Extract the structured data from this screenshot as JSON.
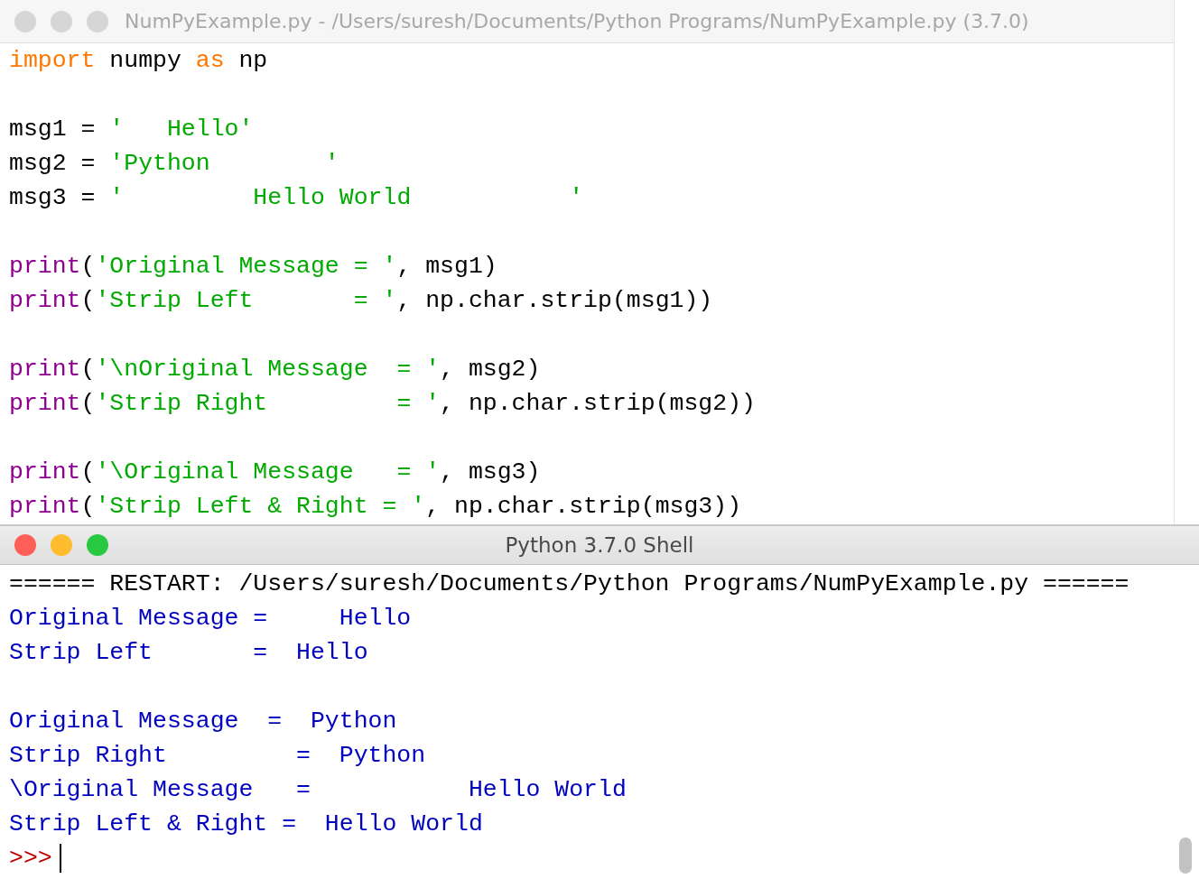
{
  "editor": {
    "title": "NumPyExample.py - /Users/suresh/Documents/Python Programs/NumPyExample.py (3.7.0)",
    "active": false,
    "blocks": [
      {
        "lines": [
          [
            {
              "kind": "keyword",
              "text": "import"
            },
            {
              "kind": "plain",
              "text": " numpy "
            },
            {
              "kind": "keyword",
              "text": "as"
            },
            {
              "kind": "plain",
              "text": " np"
            }
          ]
        ]
      },
      {
        "lines": [
          [
            {
              "kind": "plain",
              "text": "msg1 = "
            },
            {
              "kind": "string",
              "text": "'   Hello'"
            }
          ],
          [
            {
              "kind": "plain",
              "text": "msg2 = "
            },
            {
              "kind": "string",
              "text": "'Python        '"
            }
          ],
          [
            {
              "kind": "plain",
              "text": "msg3 = "
            },
            {
              "kind": "string",
              "text": "'         Hello World           '"
            }
          ]
        ]
      },
      {
        "lines": [
          [
            {
              "kind": "builtin",
              "text": "print"
            },
            {
              "kind": "plain",
              "text": "("
            },
            {
              "kind": "string",
              "text": "'Original Message = '"
            },
            {
              "kind": "plain",
              "text": ", msg1)"
            }
          ],
          [
            {
              "kind": "builtin",
              "text": "print"
            },
            {
              "kind": "plain",
              "text": "("
            },
            {
              "kind": "string",
              "text": "'Strip Left       = '"
            },
            {
              "kind": "plain",
              "text": ", np.char.strip(msg1))"
            }
          ]
        ]
      },
      {
        "lines": [
          [
            {
              "kind": "builtin",
              "text": "print"
            },
            {
              "kind": "plain",
              "text": "("
            },
            {
              "kind": "string",
              "text": "'\\nOriginal Message  = '"
            },
            {
              "kind": "plain",
              "text": ", msg2)"
            }
          ],
          [
            {
              "kind": "builtin",
              "text": "print"
            },
            {
              "kind": "plain",
              "text": "("
            },
            {
              "kind": "string",
              "text": "'Strip Right         = '"
            },
            {
              "kind": "plain",
              "text": ", np.char.strip(msg2))"
            }
          ]
        ]
      },
      {
        "lines": [
          [
            {
              "kind": "builtin",
              "text": "print"
            },
            {
              "kind": "plain",
              "text": "("
            },
            {
              "kind": "string",
              "text": "'\\Original Message   = '"
            },
            {
              "kind": "plain",
              "text": ", msg3)"
            }
          ],
          [
            {
              "kind": "builtin",
              "text": "print"
            },
            {
              "kind": "plain",
              "text": "("
            },
            {
              "kind": "string",
              "text": "'Strip Left & Right = '"
            },
            {
              "kind": "plain",
              "text": ", np.char.strip(msg3))"
            }
          ]
        ]
      }
    ]
  },
  "shell": {
    "title": "Python 3.7.0 Shell",
    "active": true,
    "restart_line": "====== RESTART: /Users/suresh/Documents/Python Programs/NumPyExample.py ======",
    "output_blocks": [
      {
        "lines": [
          "Original Message =     Hello",
          "Strip Left       =  Hello"
        ]
      },
      {
        "lines": [
          "Original Message  =  Python",
          "Strip Right         =  Python",
          "\\Original Message   =           Hello World",
          "Strip Left & Right =  Hello World"
        ]
      }
    ],
    "prompt": ">>>"
  }
}
